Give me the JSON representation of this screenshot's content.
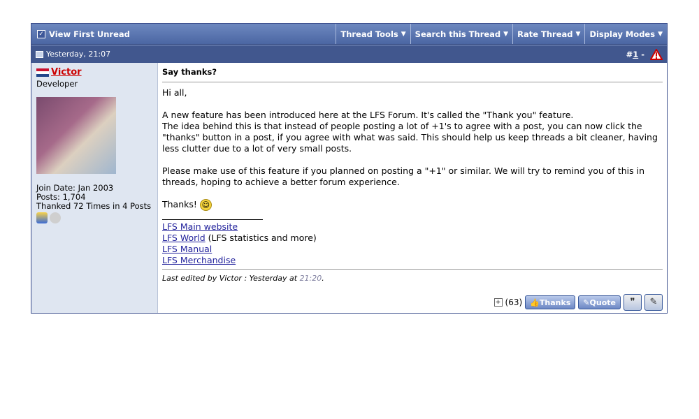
{
  "toolbar": {
    "first_unread": "View First Unread",
    "items": [
      "Thread Tools",
      "Search this Thread",
      "Rate Thread",
      "Display Modes"
    ]
  },
  "post": {
    "date": "Yesterday, 21:07",
    "number_prefix": "#",
    "number": "1",
    "number_suffix": " -"
  },
  "user": {
    "name": "Victor",
    "title": "Developer",
    "join_date": "Join Date: Jan 2003",
    "posts": "Posts: 1,704",
    "thanked": "Thanked 72 Times in 4 Posts"
  },
  "message": {
    "title": "Say thanks?",
    "greeting": "Hi all,",
    "para1_line1": "A new feature has been introduced here at the LFS Forum. It's called the \"Thank you\" feature.",
    "para1_line2": "The idea behind this is that instead of people posting a lot of +1's to agree with a post, you can now click the \"thanks\" button in a post, if you agree with what was said. This should help us keep threads a bit cleaner, having less clutter due to a lot of very small posts.",
    "para2": "Please make use of this feature if you planned on posting a \"+1\" or similar. We will try to remind you of this in threads, hoping to achieve a better forum experience.",
    "closing": "Thanks!"
  },
  "signature": {
    "link1": "LFS Main website",
    "link2": "LFS World",
    "link2_note": " (LFS statistics and more)",
    "link3": "LFS Manual",
    "link4": "LFS Merchandise"
  },
  "edit": {
    "prefix": "Last edited by Victor : Yesterday at ",
    "time": "21:20",
    "suffix": "."
  },
  "actions": {
    "count": "(63)",
    "thanks": "Thanks",
    "quote": "Quote"
  },
  "colors": {
    "accent": "#41578e",
    "username": "#cc0000",
    "link": "#22229c"
  }
}
